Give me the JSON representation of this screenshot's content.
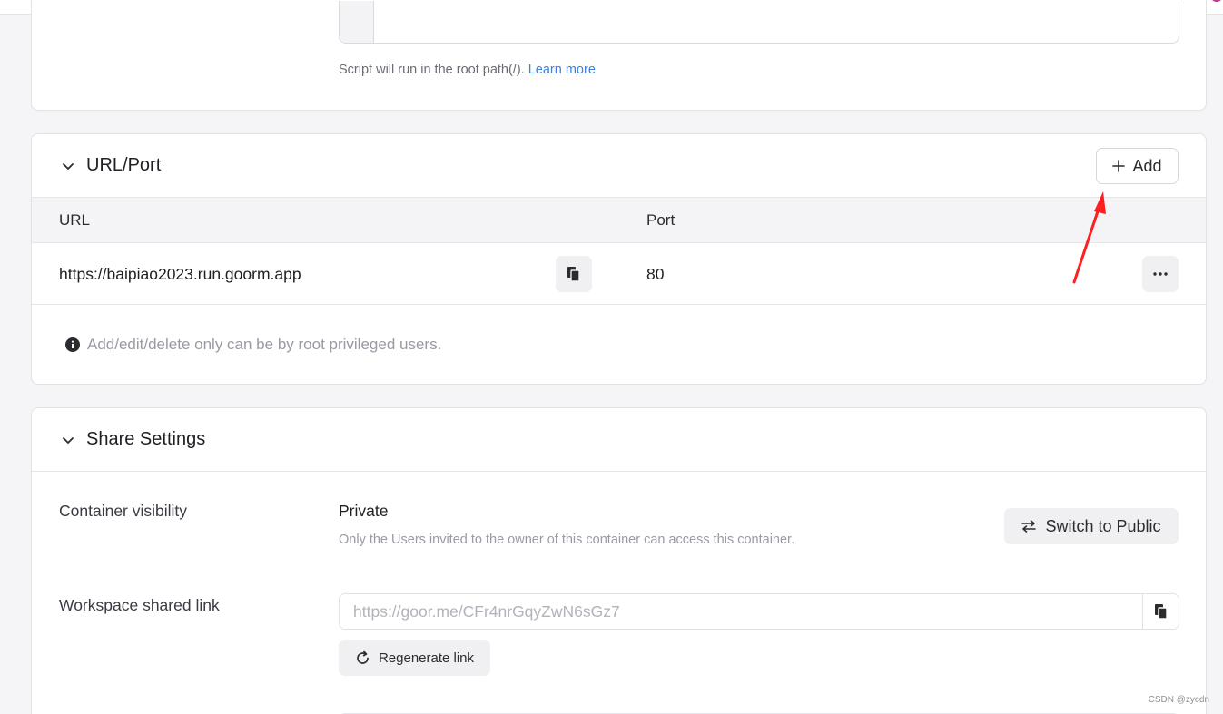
{
  "script_section": {
    "help_text": "Script will run in the root path(/).",
    "learn_more": "Learn more"
  },
  "url_port": {
    "title": "URL/Port",
    "add_label": "Add",
    "columns": [
      "URL",
      "Port"
    ],
    "rows": [
      {
        "url": "https://baipiao2023.run.goorm.app",
        "port": "80"
      }
    ],
    "note": "Add/edit/delete only can be by root privileged users."
  },
  "share_settings": {
    "title": "Share Settings",
    "container_visibility": {
      "label": "Container visibility",
      "value": "Private",
      "description": "Only the Users invited to the owner of this container can access this container.",
      "switch_label": "Switch to Public"
    },
    "workspace_link": {
      "label": "Workspace shared link",
      "value": "https://goor.me/CFr4nrGqyZwN6sGz7",
      "regenerate_label": "Regenerate link"
    }
  },
  "annotation": {
    "arrow_color": "#ff1f1f"
  },
  "watermark": "CSDN @zycdn",
  "colors": {
    "accent_link": "#3d7ee8"
  }
}
